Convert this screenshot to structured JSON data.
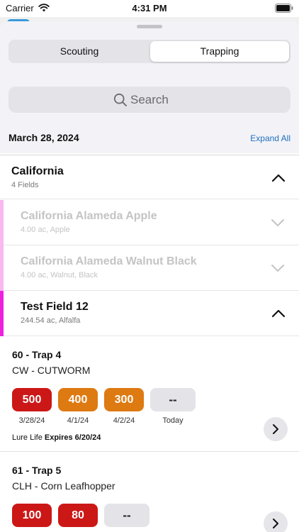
{
  "status_bar": {
    "carrier": "Carrier",
    "time": "4:31 PM"
  },
  "tabs": {
    "scouting": "Scouting",
    "trapping": "Trapping",
    "selected": "Trapping"
  },
  "search": {
    "placeholder": "Search"
  },
  "date_header": {
    "date": "March 28, 2024",
    "expand_all": "Expand All"
  },
  "group": {
    "title": "California",
    "subtitle": "4 Fields"
  },
  "fields": [
    {
      "title": "California Alameda Apple",
      "subtitle": "4.00 ac, Apple",
      "stripe_color": "#f8b8f0"
    },
    {
      "title": "California Alameda Walnut Black",
      "subtitle": "4.00 ac, Walnut, Black",
      "stripe_color": "#f8b8f0"
    },
    {
      "title": "Test Field 12",
      "subtitle": "244.54 ac, Alfalfa",
      "stripe_color": "#ee22dd"
    }
  ],
  "traps": [
    {
      "title": "60 - Trap 4",
      "pest": "CW - CUTWORM",
      "counts": [
        {
          "value": "500",
          "date": "3/28/24",
          "color": "#cc1717"
        },
        {
          "value": "400",
          "date": "4/1/24",
          "color": "#de7a12"
        },
        {
          "value": "300",
          "date": "4/2/24",
          "color": "#de7a12"
        },
        {
          "value": "--",
          "date": "Today",
          "color": "#e3e3e8"
        }
      ],
      "lure_label": "Lure Life",
      "lure_value": "Expires 6/20/24"
    },
    {
      "title": "61 - Trap 5",
      "pest": "CLH - Corn Leafhopper",
      "counts": [
        {
          "value": "100",
          "color": "#cc1717"
        },
        {
          "value": "80",
          "color": "#cc1717"
        },
        {
          "value": "--",
          "color": "#e3e3e8"
        }
      ]
    }
  ]
}
